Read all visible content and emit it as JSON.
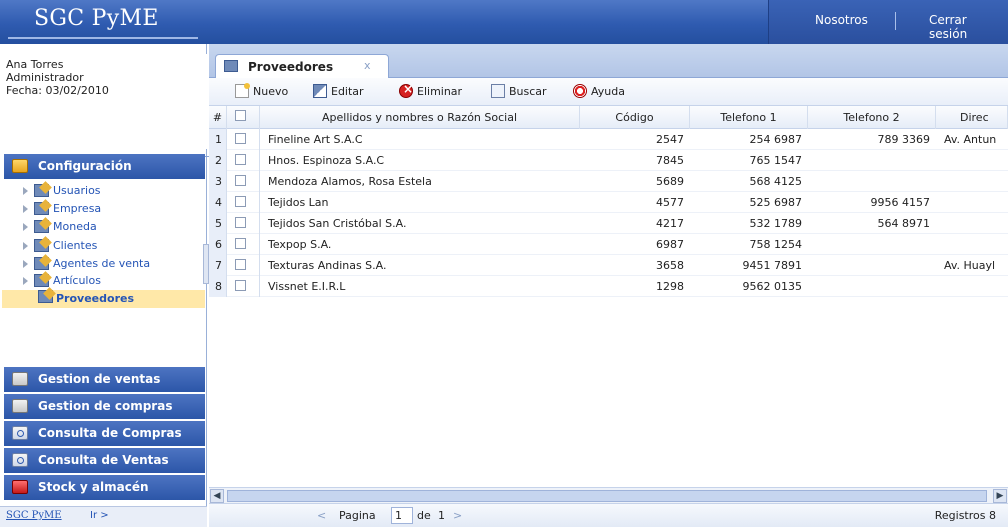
{
  "app": {
    "brand": "SGC PyME"
  },
  "topnav": {
    "about": "Nosotros",
    "logout": "Cerrar sesión"
  },
  "user": {
    "name": "Ana Torres",
    "role": "Administrador",
    "date": "Fecha: 03/02/2010"
  },
  "sidebar": {
    "config_title": "Configuración",
    "tree": [
      "Usuarios",
      "Empresa",
      "Moneda",
      "Clientes",
      "Agentes de venta",
      "Artículos"
    ],
    "selected": "Proveedores",
    "sections": [
      {
        "label": "Gestion de ventas",
        "icon": "folder-grey-icon"
      },
      {
        "label": "Gestion de compras",
        "icon": "folder-grey-icon"
      },
      {
        "label": "Consulta de Compras",
        "icon": "search-icon"
      },
      {
        "label": "Consulta de Ventas",
        "icon": "search-icon"
      },
      {
        "label": "Stock y almacén",
        "icon": "box-icon"
      }
    ],
    "footer_brand": "SGC PyME",
    "footer_go": "Ir >"
  },
  "tab": {
    "label": "Proveedores",
    "close": "x"
  },
  "toolbar": {
    "new": "Nuevo",
    "edit": "Editar",
    "delete": "Eliminar",
    "search": "Buscar",
    "help": "Ayuda"
  },
  "grid": {
    "columns": [
      "#",
      "",
      "Apellidos y nombres o Razón Social",
      "Código",
      "Telefono 1",
      "Telefono 2",
      "Direc"
    ],
    "rows": [
      {
        "n": "1",
        "name": "Fineline Art S.A.C",
        "code": "2547",
        "tel1": "254 6987",
        "tel2": "789 3369",
        "dir": "Av. Antun"
      },
      {
        "n": "2",
        "name": "Hnos. Espinoza S.A.C",
        "code": "7845",
        "tel1": "765 1547",
        "tel2": "",
        "dir": ""
      },
      {
        "n": "3",
        "name": "Mendoza Alamos, Rosa Estela",
        "code": "5689",
        "tel1": "568 4125",
        "tel2": "",
        "dir": ""
      },
      {
        "n": "4",
        "name": "Tejidos Lan",
        "code": "4577",
        "tel1": "525 6987",
        "tel2": "9956 4157",
        "dir": ""
      },
      {
        "n": "5",
        "name": "Tejidos San Cristóbal S.A.",
        "code": "4217",
        "tel1": "532 1789",
        "tel2": "564 8971",
        "dir": ""
      },
      {
        "n": "6",
        "name": "Texpop S.A.",
        "code": "6987",
        "tel1": "758 1254",
        "tel2": "",
        "dir": ""
      },
      {
        "n": "7",
        "name": "Texturas Andinas S.A.",
        "code": "3658",
        "tel1": "9451 7891",
        "tel2": "",
        "dir": "Av. Huayl"
      },
      {
        "n": "8",
        "name": "Vissnet E.I.R.L",
        "code": "1298",
        "tel1": "9562 0135",
        "tel2": "",
        "dir": ""
      }
    ]
  },
  "pager": {
    "prev": "<",
    "label": "Pagina",
    "page": "1",
    "of": "de",
    "total": "1",
    "next": ">",
    "records": "Registros  8"
  }
}
